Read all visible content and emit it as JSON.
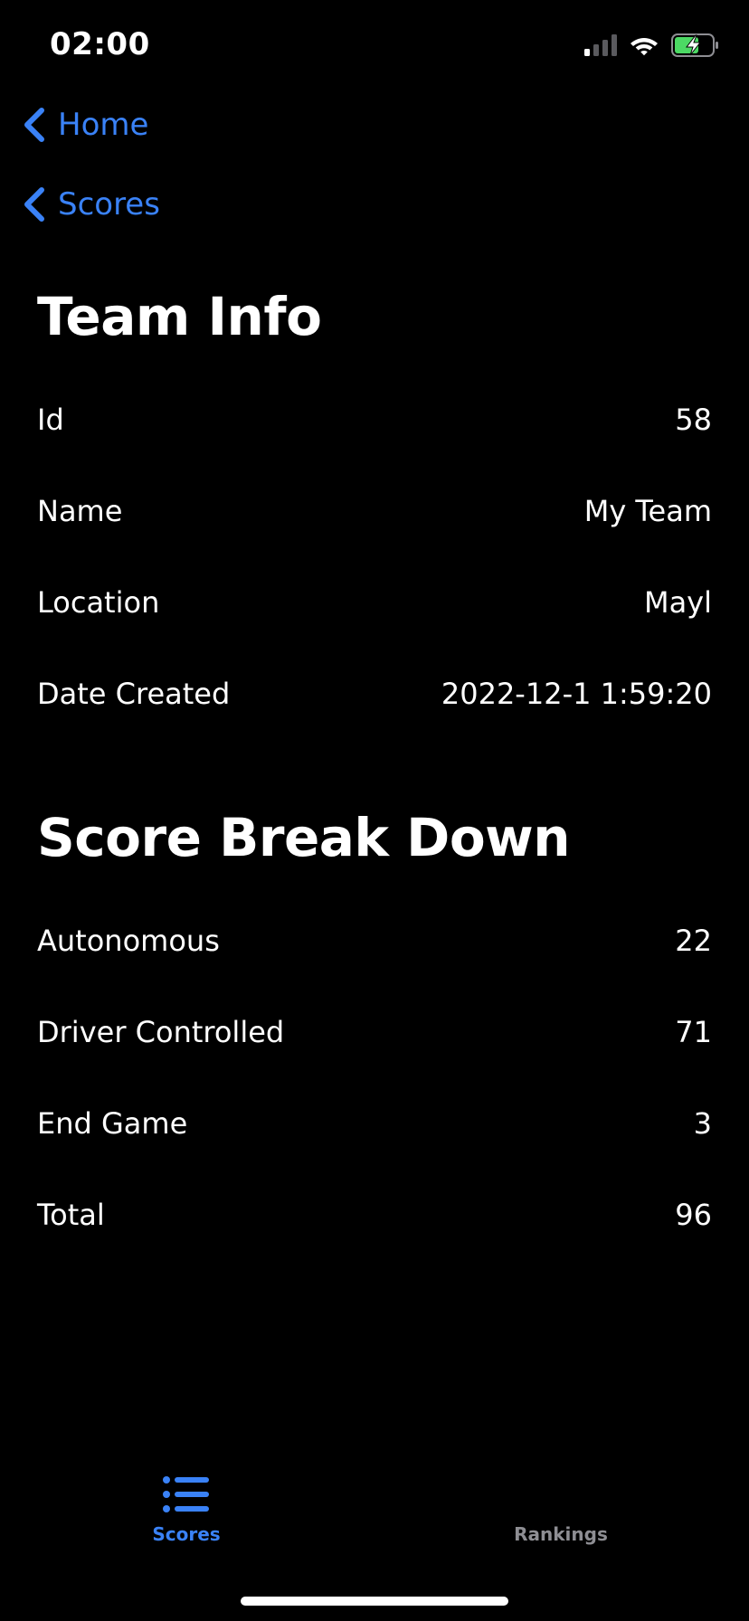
{
  "status_bar": {
    "time": "02:00",
    "icons": [
      "cellular-signal-icon",
      "wifi-icon",
      "battery-charging-icon"
    ],
    "battery_color": "#4cd964"
  },
  "nav": {
    "back_home": "Home",
    "back_scores": "Scores"
  },
  "team_info": {
    "title": "Team Info",
    "rows": [
      {
        "label": "Id",
        "value": "58"
      },
      {
        "label": "Name",
        "value": "My Team"
      },
      {
        "label": "Location",
        "value": "Mayl"
      },
      {
        "label": "Date Created",
        "value": "2022-12-1 1:59:20"
      }
    ]
  },
  "score_breakdown": {
    "title": "Score Break Down",
    "rows": [
      {
        "label": "Autonomous",
        "value": "22"
      },
      {
        "label": "Driver Controlled",
        "value": "71"
      },
      {
        "label": "End Game",
        "value": "3"
      },
      {
        "label": "Total",
        "value": "96"
      }
    ]
  },
  "tab_bar": {
    "tabs": [
      {
        "label": "Scores",
        "icon": "list-icon",
        "selected": true
      },
      {
        "label": "Rankings",
        "icon": "",
        "selected": false
      }
    ]
  },
  "colors": {
    "accent": "#3a82f7",
    "inactive_tab": "#8e8e93",
    "background": "#000000",
    "text": "#ffffff"
  }
}
